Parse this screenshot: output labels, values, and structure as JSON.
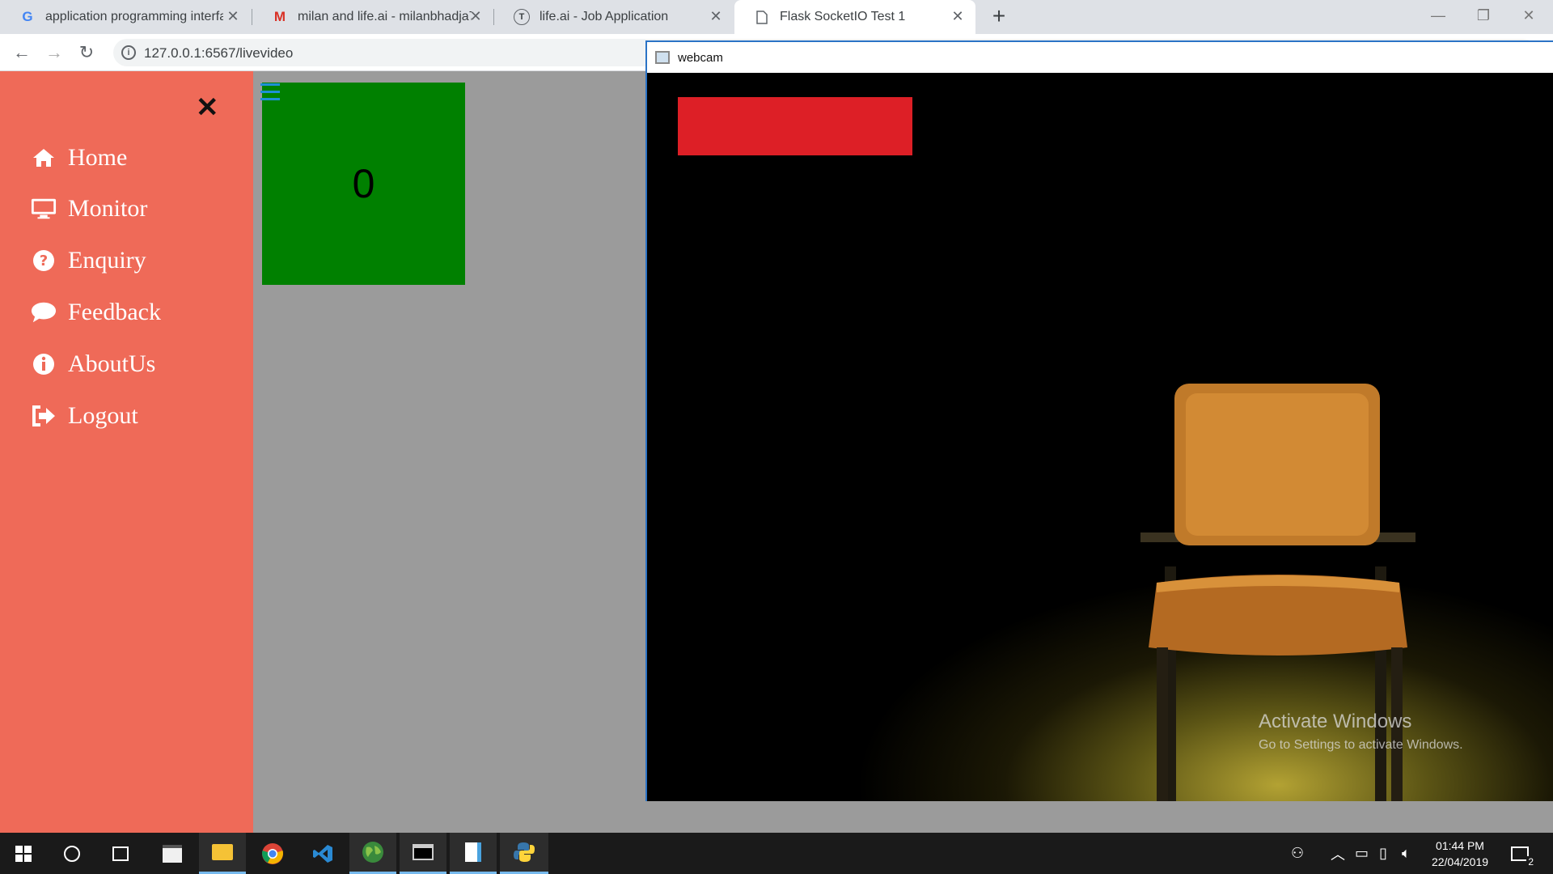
{
  "browser": {
    "tabs": [
      {
        "title": "application programming interfa",
        "icon": "google-g-icon",
        "active": false
      },
      {
        "title": "milan and life.ai - milanbhadja79",
        "icon": "gmail-icon",
        "active": false
      },
      {
        "title": "life.ai - Job Application",
        "icon": "letter-t-icon",
        "active": false
      },
      {
        "title": "Flask SocketIO Test 1",
        "icon": "document-icon",
        "active": true
      }
    ],
    "url": "127.0.0.1:6567/livevideo"
  },
  "sidebar": {
    "items": [
      {
        "label": "Home",
        "icon": "home-icon"
      },
      {
        "label": "Monitor",
        "icon": "monitor-icon"
      },
      {
        "label": "Enquiry",
        "icon": "question-circle-icon"
      },
      {
        "label": "Feedback",
        "icon": "comment-icon"
      },
      {
        "label": "AboutUs",
        "icon": "info-circle-icon"
      },
      {
        "label": "Logout",
        "icon": "sign-out-icon"
      }
    ]
  },
  "main": {
    "counter_value": "0",
    "counter_color": "#008000"
  },
  "webcam_window": {
    "title": "webcam",
    "overlay_color": "#dd1f26"
  },
  "watermark": {
    "line1": "Activate Windows",
    "line2": "Go to Settings to activate Windows."
  },
  "taskbar": {
    "time": "01:44 PM",
    "date": "22/04/2019",
    "notification_count": "2"
  },
  "colors": {
    "sidebar_bg": "#ef6a58",
    "page_bg": "#9b9b9b",
    "accent": "#2b73c6"
  }
}
